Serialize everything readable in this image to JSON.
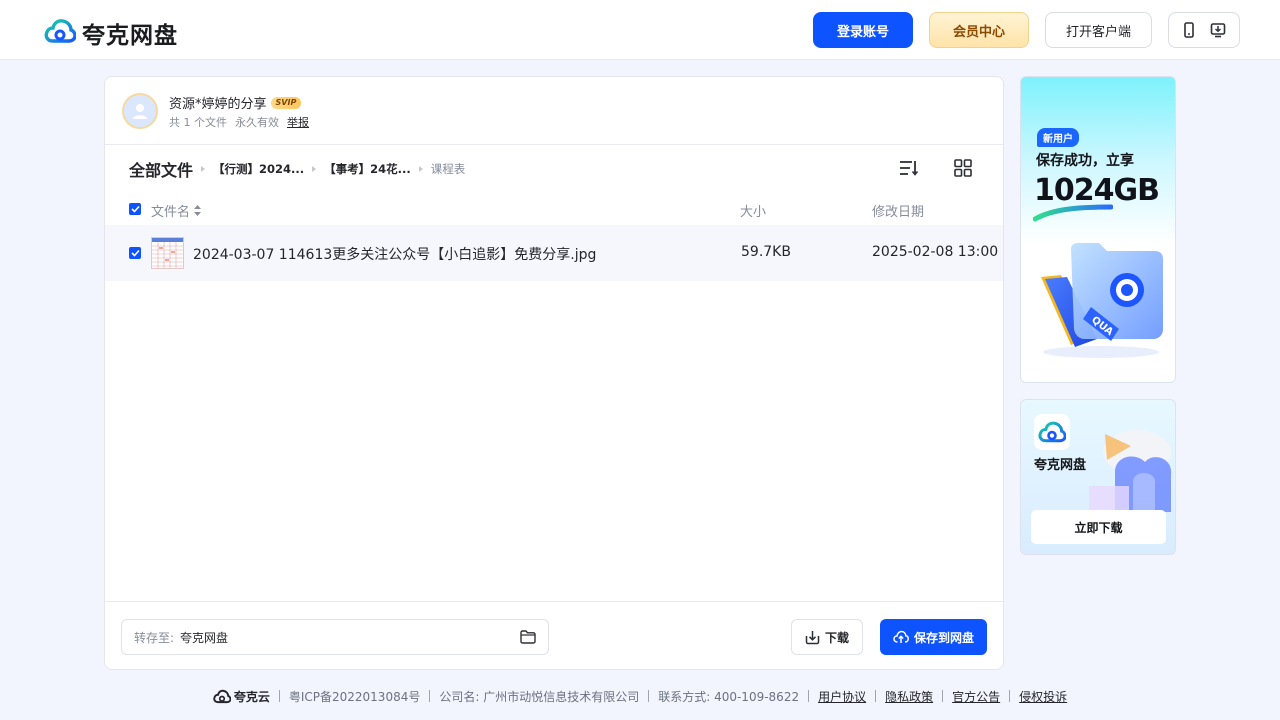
{
  "brand": {
    "name": "夸克网盘"
  },
  "header": {
    "login": "登录账号",
    "vip": "会员中心",
    "client": "打开客户端",
    "icons": [
      "phone-icon",
      "desktop-download-icon"
    ]
  },
  "share": {
    "title": "资源*婷婷的分享",
    "badge": "SVIP",
    "count": "共 1 个文件",
    "validity": "永久有效",
    "report": "举报"
  },
  "breadcrumb": [
    "全部文件",
    "【行测】2024...",
    "【事考】24花...",
    "课程表"
  ],
  "columns": {
    "name": "文件名",
    "size": "大小",
    "date": "修改日期"
  },
  "files": [
    {
      "name": "2024-03-07 114613更多关注公众号【小白追影】免费分享.jpg",
      "size": "59.7KB",
      "date": "2025-02-08 13:00",
      "checked": true
    }
  ],
  "footer_bar": {
    "save_label": "转存至:",
    "save_target": "夸克网盘",
    "download": "下载",
    "save_button": "保存到网盘"
  },
  "ad_new_user": {
    "tag": "新用户",
    "line1": "保存成功，立享",
    "big": "1024GB"
  },
  "ad_download": {
    "name": "夸克网盘",
    "button": "立即下载"
  },
  "site_footer": {
    "brand": "夸克云",
    "icp": "粤ICP备2022013084号",
    "company": "公司名: 广州市动悦信息技术有限公司",
    "contact": "联系方式: 400-109-8622",
    "links": [
      "用户协议",
      "隐私政策",
      "官方公告",
      "侵权投诉"
    ]
  },
  "colors": {
    "accent": "#0d53ff",
    "background": "#f2f5fd",
    "vip": "#8a4b00"
  }
}
